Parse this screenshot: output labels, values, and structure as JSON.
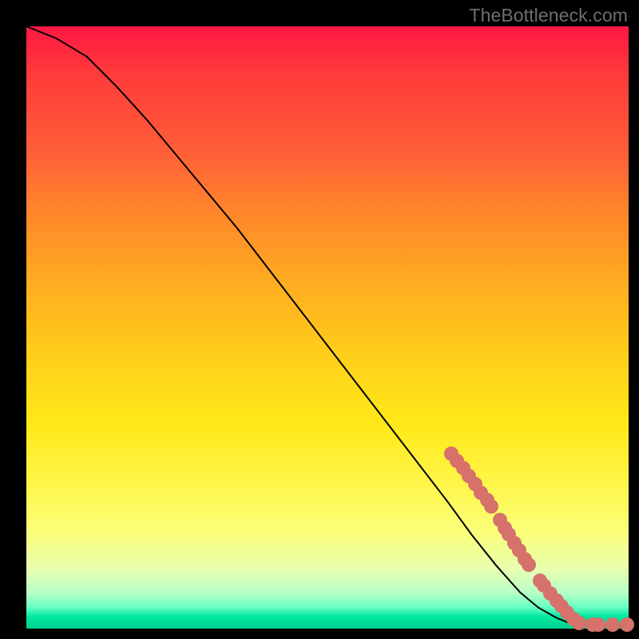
{
  "watermark": "TheBottleneck.com",
  "chart_data": {
    "type": "line",
    "title": "",
    "xlabel": "",
    "ylabel": "",
    "xlim": [
      0,
      100
    ],
    "ylim": [
      0,
      100
    ],
    "series": [
      {
        "name": "curve",
        "x": [
          0,
          5,
          10,
          15,
          20,
          25,
          30,
          35,
          40,
          45,
          50,
          55,
          60,
          65,
          70,
          74,
          78,
          82,
          85,
          88,
          90,
          92,
          94,
          96,
          98,
          100
        ],
        "y": [
          100,
          98,
          95,
          90,
          84.5,
          78.5,
          72.5,
          66.5,
          60,
          53.5,
          47,
          40.5,
          34,
          27.5,
          21,
          15.5,
          10.5,
          6,
          3.5,
          1.8,
          1.0,
          0.7,
          0.6,
          0.55,
          0.5,
          0.5
        ]
      }
    ],
    "points": [
      {
        "x": 70.5,
        "y": 29.0
      },
      {
        "x": 71.5,
        "y": 27.8
      },
      {
        "x": 72.5,
        "y": 26.6
      },
      {
        "x": 73.5,
        "y": 25.3
      },
      {
        "x": 74.5,
        "y": 24.0
      },
      {
        "x": 75.5,
        "y": 22.6
      },
      {
        "x": 76.5,
        "y": 21.3
      },
      {
        "x": 77.2,
        "y": 20.3
      },
      {
        "x": 78.6,
        "y": 18.0
      },
      {
        "x": 79.4,
        "y": 16.7
      },
      {
        "x": 80.1,
        "y": 15.6
      },
      {
        "x": 81.0,
        "y": 14.2
      },
      {
        "x": 81.8,
        "y": 13.0
      },
      {
        "x": 82.7,
        "y": 11.6
      },
      {
        "x": 83.4,
        "y": 10.6
      },
      {
        "x": 85.3,
        "y": 8.0
      },
      {
        "x": 86.0,
        "y": 7.1
      },
      {
        "x": 87.0,
        "y": 5.9
      },
      {
        "x": 88.0,
        "y": 4.7
      },
      {
        "x": 88.8,
        "y": 3.7
      },
      {
        "x": 89.8,
        "y": 2.6
      },
      {
        "x": 90.8,
        "y": 1.6
      },
      {
        "x": 91.8,
        "y": 0.95
      },
      {
        "x": 94.0,
        "y": 0.7
      },
      {
        "x": 95.0,
        "y": 0.65
      },
      {
        "x": 97.3,
        "y": 0.6
      },
      {
        "x": 99.8,
        "y": 0.6
      }
    ],
    "marker_color": "#d6716b",
    "line_color": "#000000"
  }
}
